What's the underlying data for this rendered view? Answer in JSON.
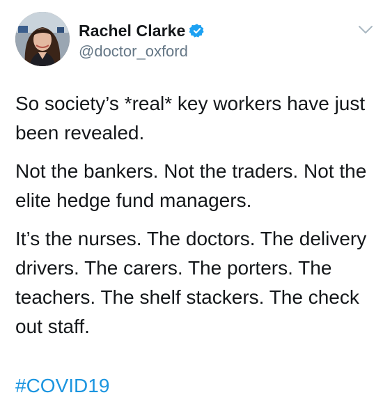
{
  "author": {
    "display_name": "Rachel Clarke",
    "handle": "@doctor_oxford",
    "verified": true,
    "avatar_icon": "profile-photo-icon"
  },
  "menu_icon": "chevron-down-icon",
  "tweet": {
    "paragraphs": [
      "So society’s  *real* key workers have just been revealed.",
      "Not the bankers. Not the traders. Not the elite hedge fund managers.",
      "It’s the nurses. The doctors. The delivery drivers. The carers. The porters. The teachers. The shelf stackers. The check out staff."
    ],
    "hashtag": "#COVID19"
  },
  "colors": {
    "text": "#14171a",
    "secondary_text": "#657786",
    "link": "#1b95e0",
    "verified_badge": "#1da1f2"
  }
}
